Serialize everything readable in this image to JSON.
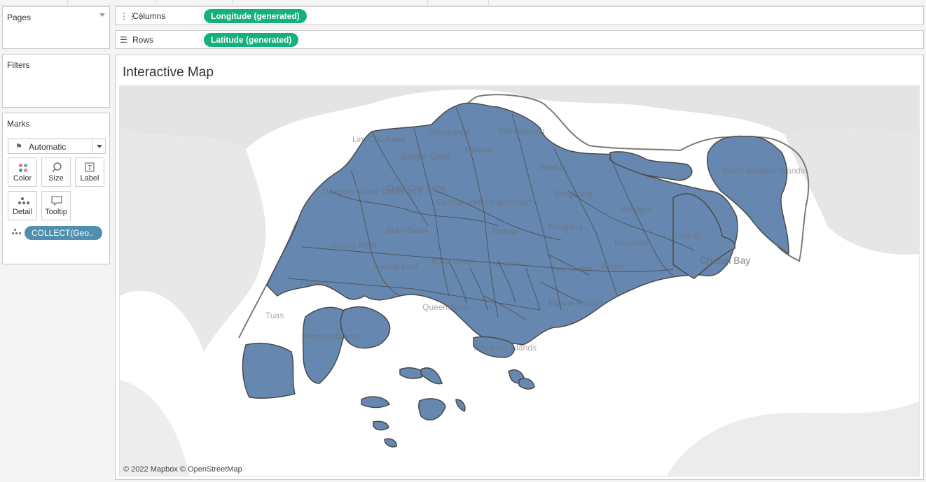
{
  "pages_card": {
    "title": "Pages"
  },
  "filters_card": {
    "title": "Filters"
  },
  "marks_card": {
    "title": "Marks",
    "mark_type": "Automatic",
    "buttons": [
      {
        "label": "Color",
        "icon": "color-icon"
      },
      {
        "label": "Size",
        "icon": "size-icon"
      },
      {
        "label": "Label",
        "icon": "label-icon"
      },
      {
        "label": "Detail",
        "icon": "detail-icon"
      },
      {
        "label": "Tooltip",
        "icon": "tooltip-icon"
      }
    ],
    "field_pill": "COLLECT(Geo.."
  },
  "columns_shelf": {
    "label": "Columns",
    "pill": "Longitude (generated)"
  },
  "rows_shelf": {
    "label": "Rows",
    "pill": "Latitude (generated)"
  },
  "view": {
    "title": "Interactive Map",
    "attribution": "© 2022 Mapbox © OpenStreetMap"
  },
  "map": {
    "fill_color": "#6688b0",
    "border_color": "#4a4a4a",
    "place_labels": [
      "Lim Chu Kang",
      "Woodlands",
      "Sembawang",
      "Mandai",
      "Sungei Kadut",
      "Seletar",
      "North-Eastern Islands",
      "Western Water Catchment",
      "Choa Chu Kang",
      "Central Water Catchment",
      "Sengkang",
      "Punggol",
      "Bukit Batok",
      "Bishan",
      "Hougang",
      "Changi",
      "Jurong West",
      "Tampines",
      "Changi Bay",
      "Jurong East",
      "Bukit Timah",
      "Novena",
      "Paya Lebar",
      "Bedok",
      "Pioneer",
      "Queenstown",
      "Marine Parade",
      "Tuas",
      "Western Islands",
      "Southern Islands"
    ]
  }
}
